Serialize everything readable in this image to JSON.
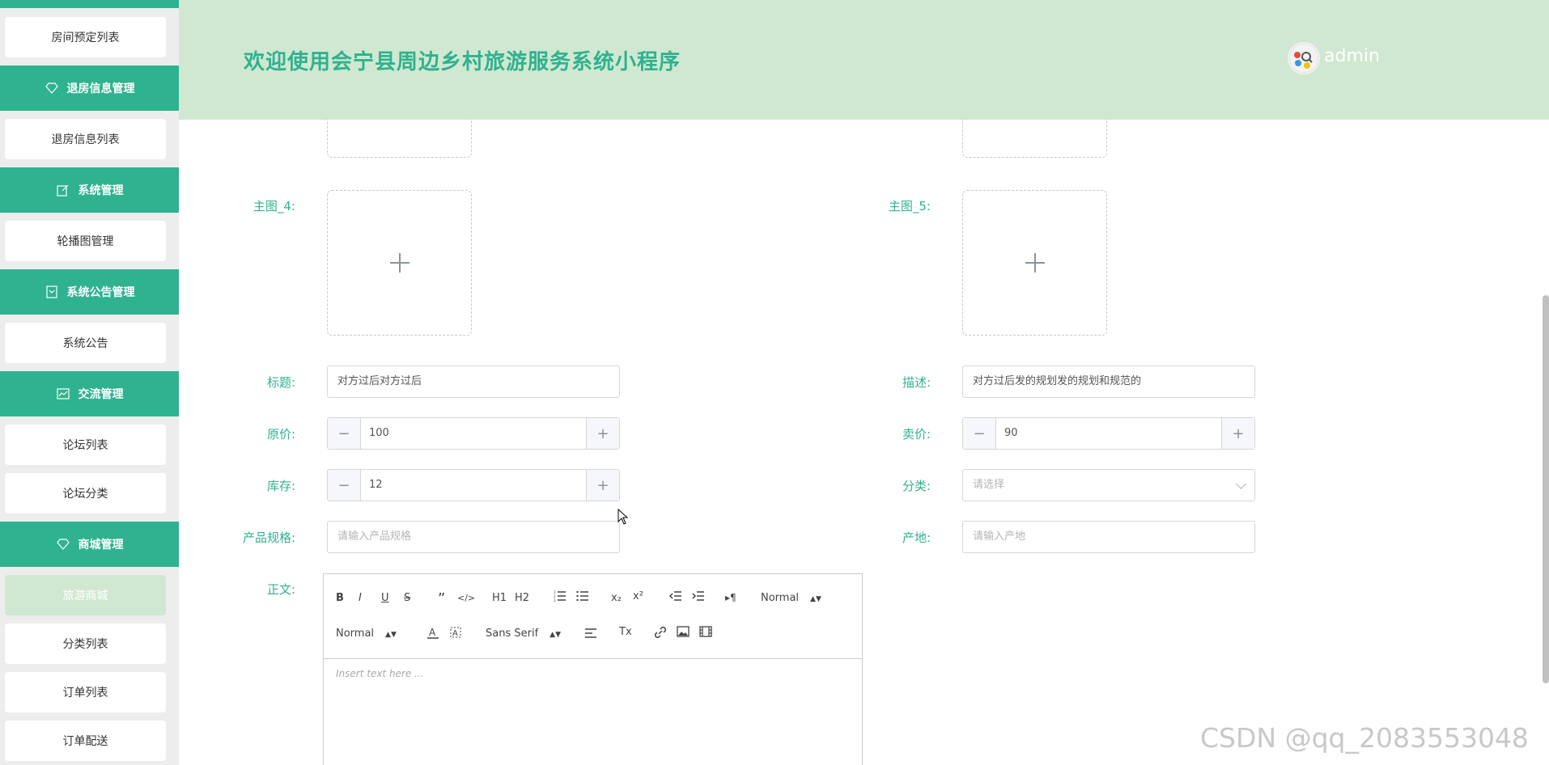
{
  "header": {
    "title": "欢迎使用会宁县周边乡村旅游服务系统小程序",
    "user": "admin"
  },
  "sidebar": {
    "items": [
      {
        "label": "房间预定列表"
      },
      {
        "group": "退房信息管理"
      },
      {
        "label": "退房信息列表"
      },
      {
        "group": "系统管理"
      },
      {
        "label": "轮播图管理"
      },
      {
        "group": "系统公告管理"
      },
      {
        "label": "系统公告"
      },
      {
        "group": "交流管理"
      },
      {
        "label": "论坛列表"
      },
      {
        "label": "论坛分类"
      },
      {
        "group": "商城管理"
      },
      {
        "label": "旅游商城",
        "active": true
      },
      {
        "label": "分类列表"
      },
      {
        "label": "订单列表"
      },
      {
        "label": "订单配送"
      }
    ]
  },
  "form": {
    "main_image_4_label": "主图_4:",
    "main_image_5_label": "主图_5:",
    "title_label": "标题:",
    "title_value": "对方过后对方过后",
    "description_label": "描述:",
    "description_value": "对方过后发的规划发的规划和规范的",
    "original_price_label": "原价:",
    "original_price_value": "100",
    "sale_price_label": "卖价:",
    "sale_price_value": "90",
    "stock_label": "库存:",
    "stock_value": "12",
    "category_label": "分类:",
    "category_placeholder": "请选择",
    "spec_label": "产品规格:",
    "spec_placeholder": "请输入产品规格",
    "origin_label": "产地:",
    "origin_placeholder": "请输入产地",
    "content_label": "正文:"
  },
  "editor": {
    "toolbar": {
      "bold": "B",
      "italic": "I",
      "underline": "U",
      "strike": "S",
      "blockquote": "”",
      "code": "</>",
      "h1": "H1",
      "h2": "H2",
      "sub": "x₂",
      "sup": "x²",
      "direction": "▸¶",
      "header_select": "Normal",
      "size_select": "Normal",
      "font_select": "Sans Serif",
      "clean": "Tx"
    },
    "placeholder": "Insert text here ..."
  },
  "watermark": "CSDN @qq_2083553048",
  "colors": {
    "brand": "#2fb28f",
    "header_bg": "#d0e8d1"
  }
}
